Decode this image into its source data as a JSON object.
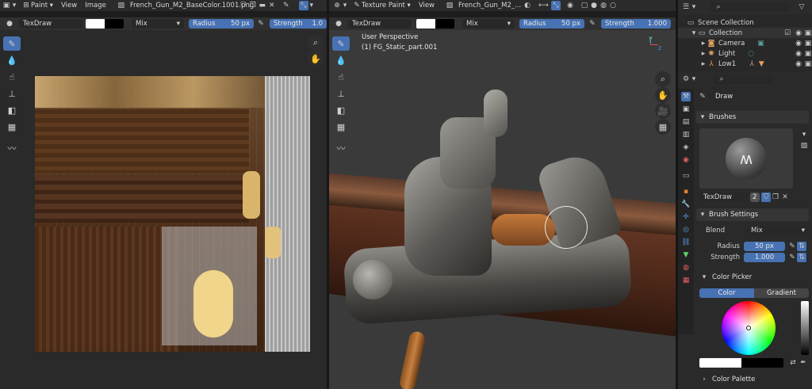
{
  "image_editor": {
    "header": {
      "mode": "Paint",
      "menus": [
        "View",
        "Image"
      ],
      "image_name": "French_Gun_M2_BaseColor.1001.png"
    },
    "toolbar": {
      "brush": "TexDraw",
      "blend": "Mix",
      "radius_label": "Radius",
      "radius_value": "50 px",
      "strength_label": "Strength",
      "strength_value": "1.0"
    }
  },
  "viewport": {
    "header": {
      "mode": "Texture Paint",
      "menus": [
        "View"
      ],
      "image_name": "French_Gun_M2_..."
    },
    "toolbar": {
      "brush": "TexDraw",
      "blend": "Mix",
      "radius_label": "Radius",
      "radius_value": "50 px",
      "strength_label": "Strength",
      "strength_value": "1.000"
    },
    "overlay": {
      "perspective": "User Perspective",
      "object": "(1) FG_Static_part.001"
    },
    "gizmo": {
      "y": "y",
      "z": "z"
    }
  },
  "outliner": {
    "rows": [
      {
        "label": "Scene Collection",
        "indent": 0
      },
      {
        "label": "Collection",
        "indent": 1
      },
      {
        "label": "Camera",
        "indent": 2
      },
      {
        "label": "Light",
        "indent": 2
      },
      {
        "label": "Low1",
        "indent": 2
      }
    ]
  },
  "properties": {
    "tool_name": "Draw",
    "brushes": {
      "title": "Brushes",
      "brush_name": "TexDraw",
      "users": "2"
    },
    "brush_settings": {
      "title": "Brush Settings",
      "blend_label": "Blend",
      "blend_value": "Mix",
      "radius_label": "Radius",
      "radius_value": "50 px",
      "strength_label": "Strength",
      "strength_value": "1.000"
    },
    "color_picker": {
      "title": "Color Picker",
      "tab_color": "Color",
      "tab_gradient": "Gradient"
    },
    "color_palette": {
      "title": "Color Palette"
    }
  },
  "colors": {
    "accent": "#4772b3",
    "panel": "#303030",
    "header": "#2b2b2b"
  }
}
